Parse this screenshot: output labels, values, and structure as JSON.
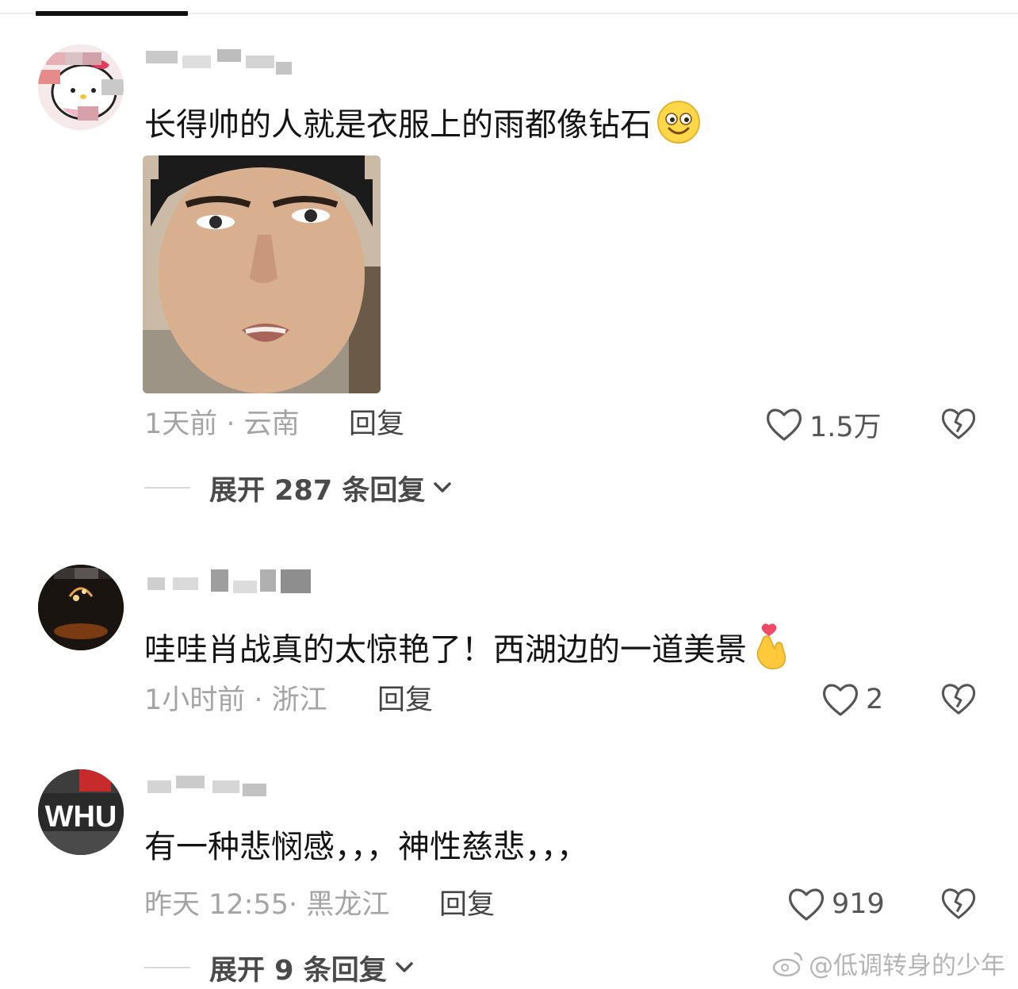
{
  "comments": [
    {
      "text": "长得帅的人就是衣服上的雨都像钻石",
      "emoji_icon": "smiley-face-icon",
      "has_photo": true,
      "time_location": "1天前 · 云南",
      "reply_label": "回复",
      "likes": "1.5万",
      "expand_label": "展开 287 条回复"
    },
    {
      "text": "哇哇肖战真的太惊艳了！西湖边的一道美景",
      "emoji_icon": "finger-heart-icon",
      "time_location": "1小时前 · 浙江",
      "reply_label": "回复",
      "likes": "2"
    },
    {
      "text": "有一种悲悯感，，，神性慈悲，，，",
      "time_location": "昨天 12:55· 黑龙江",
      "reply_label": "回复",
      "likes": "919",
      "expand_label": "展开 9 条回复",
      "avatar_text": "WHU"
    }
  ],
  "watermark": "@低调转身的少年",
  "colors": {
    "like_icon": "#555555",
    "muted_text": "#a4a4a4",
    "primary_text": "#141414"
  }
}
